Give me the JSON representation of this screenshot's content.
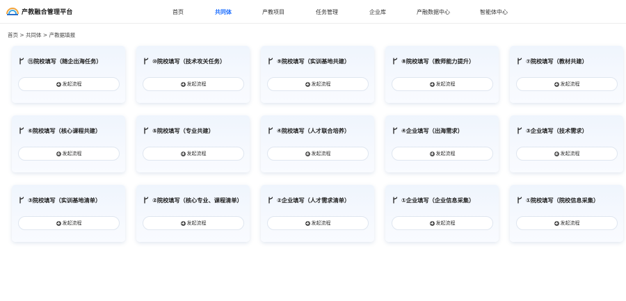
{
  "app": {
    "title": "产教融合管理平台"
  },
  "nav": {
    "items": [
      {
        "label": "首页",
        "active": false
      },
      {
        "label": "共同体",
        "active": true
      },
      {
        "label": "产教项目",
        "active": false
      },
      {
        "label": "任务管理",
        "active": false
      },
      {
        "label": "企业库",
        "active": false
      },
      {
        "label": "产融数据中心",
        "active": false
      },
      {
        "label": "智能体中心",
        "active": false
      }
    ]
  },
  "breadcrumb": "首页 > 共同体 > 产教据填报",
  "cards": [
    {
      "title": "⑪院校填写（随企出海任务）",
      "button": "发起流程"
    },
    {
      "title": "⑩院校填写（技术攻关任务）",
      "button": "发起流程"
    },
    {
      "title": "⑨院校填写（实训基地共建）",
      "button": "发起流程"
    },
    {
      "title": "⑧院校填写（教师能力提升）",
      "button": "发起流程"
    },
    {
      "title": "⑦院校填写（教材共建）",
      "button": "发起流程"
    },
    {
      "title": "⑥院校填写（核心课程共建）",
      "button": "发起流程"
    },
    {
      "title": "⑤院校填写（专业共建）",
      "button": "发起流程"
    },
    {
      "title": "④院校填写（人才联合培养）",
      "button": "发起流程"
    },
    {
      "title": "④企业填写（出海需求）",
      "button": "发起流程"
    },
    {
      "title": "③企业填写（技术需求）",
      "button": "发起流程"
    },
    {
      "title": "③院校填写（实训基地清单）",
      "button": "发起流程"
    },
    {
      "title": "②院校填写（核心专业、课程清单）",
      "button": "发起流程"
    },
    {
      "title": "②企业填写（人才需求清单）",
      "button": "发起流程"
    },
    {
      "title": "①企业填写（企业信息采集）",
      "button": "发起流程"
    },
    {
      "title": "①院校填写（院校信息采集）",
      "button": "发起流程"
    }
  ],
  "colors": {
    "accent": "#1e6fff",
    "card_bg": "#eff5fd"
  },
  "icons": {
    "logo": "logo-icon",
    "card": "branch-icon",
    "button": "plus-circle-icon"
  }
}
